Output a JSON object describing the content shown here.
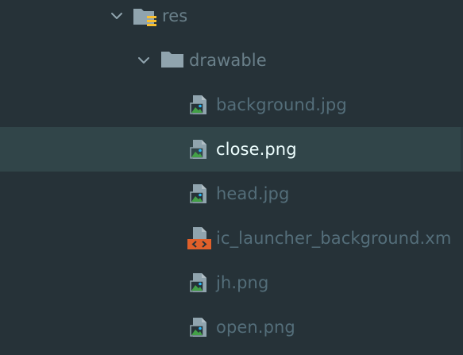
{
  "colors": {
    "background": "#263238",
    "selected_row": "#314549",
    "text_muted": "#546e7a",
    "text_selected": "#eeffff",
    "folder_gray": "#90a4ae",
    "image_green": "#43a047",
    "image_blue": "#29b6f6",
    "xml_orange": "#e0602a",
    "res_badge_yellow": "#fbc02d"
  },
  "tree": {
    "res": {
      "label": "res",
      "expanded": true,
      "icon": "resource-folder-icon"
    },
    "drawable": {
      "label": "drawable",
      "expanded": true,
      "icon": "folder-icon"
    },
    "files": [
      {
        "label": "background.jpg",
        "icon": "image-file-icon",
        "selected": false
      },
      {
        "label": "close.png",
        "icon": "image-file-icon",
        "selected": true
      },
      {
        "label": "head.jpg",
        "icon": "image-file-icon",
        "selected": false
      },
      {
        "label": "ic_launcher_background.xm",
        "icon": "xml-file-icon",
        "selected": false
      },
      {
        "label": "jh.png",
        "icon": "image-file-icon",
        "selected": false
      },
      {
        "label": "open.png",
        "icon": "image-file-icon",
        "selected": false
      }
    ]
  }
}
